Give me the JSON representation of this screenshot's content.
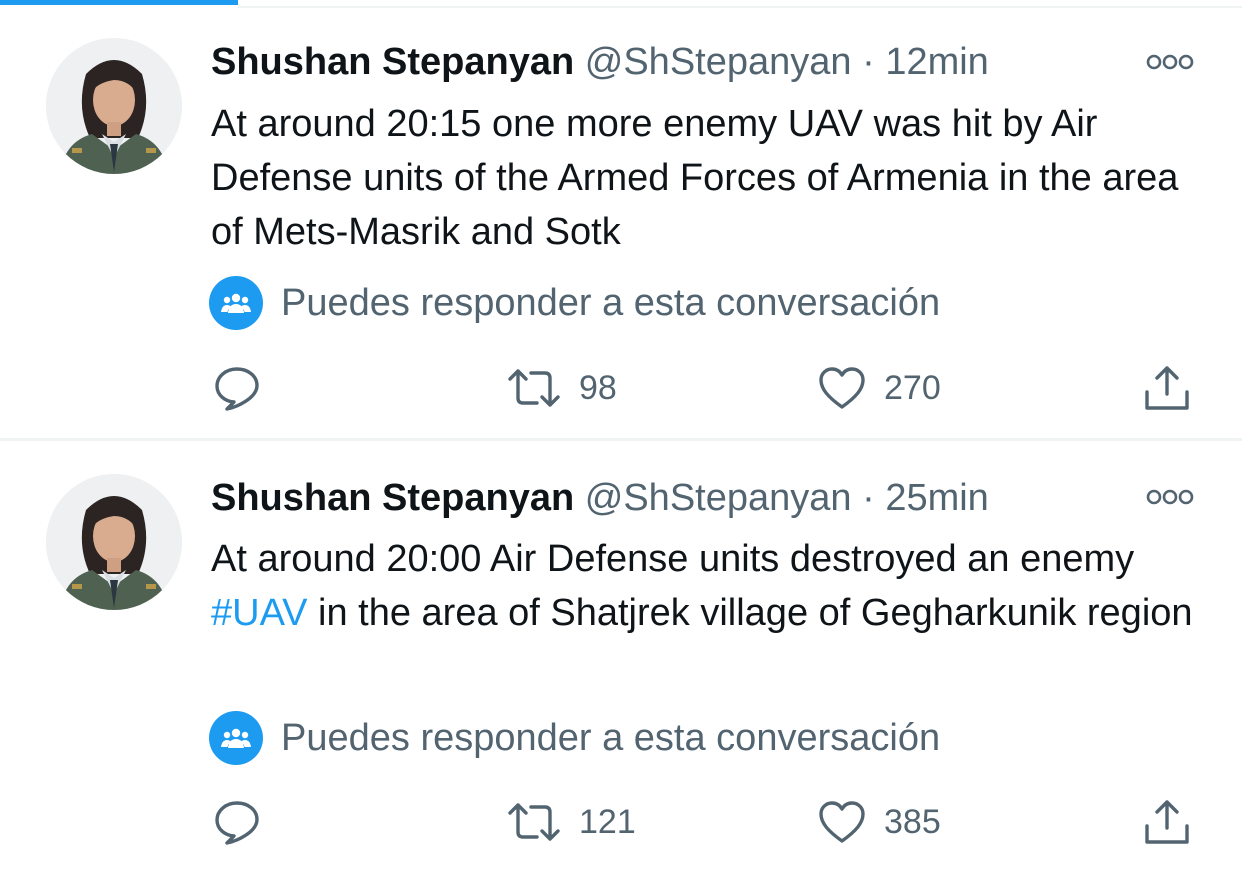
{
  "tweets": [
    {
      "author_name": "Shushan Stepanyan",
      "author_handle": "@ShStepanyan",
      "separator": "·",
      "time": "12min",
      "text": "At around 20:15 one more enemy UAV was hit by Air Defense units of the Armed Forces of Armenia in the area of Mets-Masrik and Sotk",
      "reply_note": "Puedes responder a esta conversación",
      "retweets": "98",
      "likes": "270"
    },
    {
      "author_name": "Shushan Stepanyan",
      "author_handle": "@ShStepanyan",
      "separator": "·",
      "time": "25min",
      "text_before": "At around 20:00 Air Defense units destroyed an enemy ",
      "hashtag": "#UAV",
      "text_after": " in the area of Shatjrek village of Gegharkunik region",
      "reply_note": "Puedes responder a esta conversación",
      "retweets": "121",
      "likes": "385"
    }
  ],
  "colors": {
    "accent": "#1d9bf0",
    "secondary_text": "#536471",
    "primary_text": "#0f1419",
    "divider": "#eff3f4"
  },
  "icons": [
    "more-icon",
    "people-icon",
    "reply-icon",
    "retweet-icon",
    "like-icon",
    "share-icon"
  ]
}
